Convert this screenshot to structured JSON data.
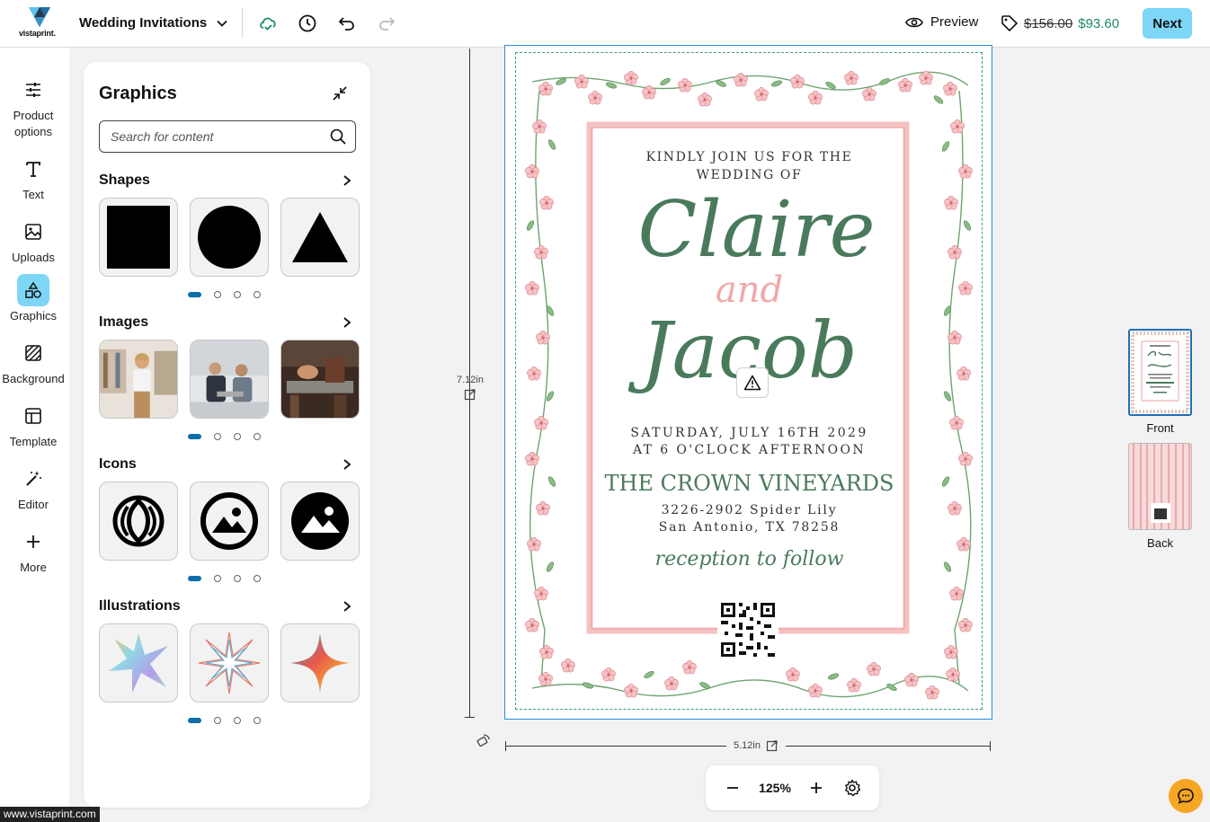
{
  "header": {
    "logo_text": "vistaprint.",
    "doc_title": "Wedding Invitations",
    "preview_label": "Preview",
    "price_old": "$156.00",
    "price_new": "$93.60",
    "next_label": "Next"
  },
  "rail": {
    "items": [
      {
        "label": "Product options",
        "icon": "sliders-icon"
      },
      {
        "label": "Text",
        "icon": "text-icon"
      },
      {
        "label": "Uploads",
        "icon": "image-upload-icon"
      },
      {
        "label": "Graphics",
        "icon": "shapes-icon",
        "active": true
      },
      {
        "label": "Background",
        "icon": "background-icon"
      },
      {
        "label": "Template",
        "icon": "template-icon"
      },
      {
        "label": "Editor",
        "icon": "magic-wand-icon"
      },
      {
        "label": "More",
        "icon": "plus-icon"
      }
    ]
  },
  "panel": {
    "title": "Graphics",
    "search_placeholder": "Search for content",
    "sections": [
      {
        "title": "Shapes",
        "items": [
          "square",
          "circle",
          "triangle"
        ],
        "active_page": 0,
        "pages": 4
      },
      {
        "title": "Images",
        "items": [
          "clothing-store-photo",
          "business-meeting-photo",
          "woodworking-photo"
        ],
        "active_page": 0,
        "pages": 4
      },
      {
        "title": "Icons",
        "items": [
          "leaf-circle-icon",
          "image-circle-outline-icon",
          "image-circle-filled-icon"
        ],
        "active_page": 0,
        "pages": 4
      },
      {
        "title": "Illustrations",
        "items": [
          "holographic-star",
          "line-starburst",
          "gradient-sparkle"
        ],
        "active_page": 0,
        "pages": 4
      }
    ]
  },
  "canvas": {
    "height_label": "7.12in",
    "width_label": "5.12in",
    "invitation": {
      "line1": "KINDLY JOIN US FOR THE",
      "line2": "WEDDING OF",
      "name1": "Claire",
      "and": "and",
      "name2": "Jacob",
      "date": "SATURDAY, JULY 16TH 2029",
      "time": "AT 6 O'CLOCK AFTERNOON",
      "venue": "THE CROWN VINEYARDS",
      "address1": "3226-2902 Spider Lily",
      "address2": "San Antonio, TX 78258",
      "reception": "reception to follow"
    }
  },
  "pages": {
    "front_label": "Front",
    "back_label": "Back"
  },
  "zoom": {
    "value": "125%"
  },
  "status_url": "www.vistaprint.com",
  "colors": {
    "accent": "#7dd6f5",
    "price_new": "#1a8a6e",
    "script_green": "#4a7a5c",
    "frame_pink": "#f0a8a8"
  }
}
